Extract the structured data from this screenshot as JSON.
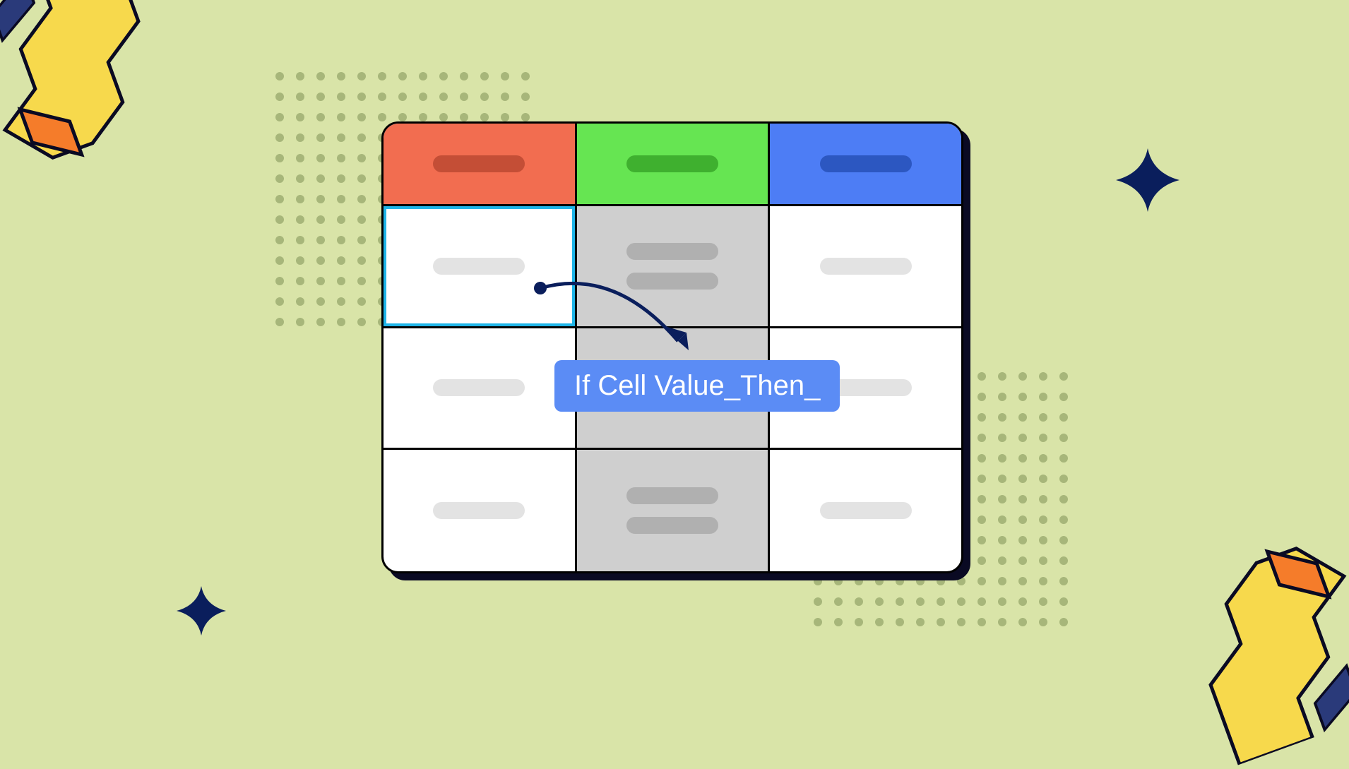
{
  "spreadsheet": {
    "columns": [
      {
        "color_name": "orange",
        "color": "#f26d50",
        "pill_color": "#c44e36"
      },
      {
        "color_name": "green",
        "color": "#66e552",
        "pill_color": "#3fb02f"
      },
      {
        "color_name": "blue",
        "color": "#4d7df5",
        "pill_color": "#2c57c1"
      }
    ],
    "selected_cell": {
      "row": 0,
      "col": 0
    },
    "highlighted_column": 1
  },
  "formula": {
    "text": "If Cell Value_Then_"
  },
  "colors": {
    "background": "#d9e4a8",
    "formula_bubble": "#5b8cf5",
    "arrow": "#0a1e5c",
    "star": "#0a1e5c",
    "dot": "#a7b67a"
  }
}
